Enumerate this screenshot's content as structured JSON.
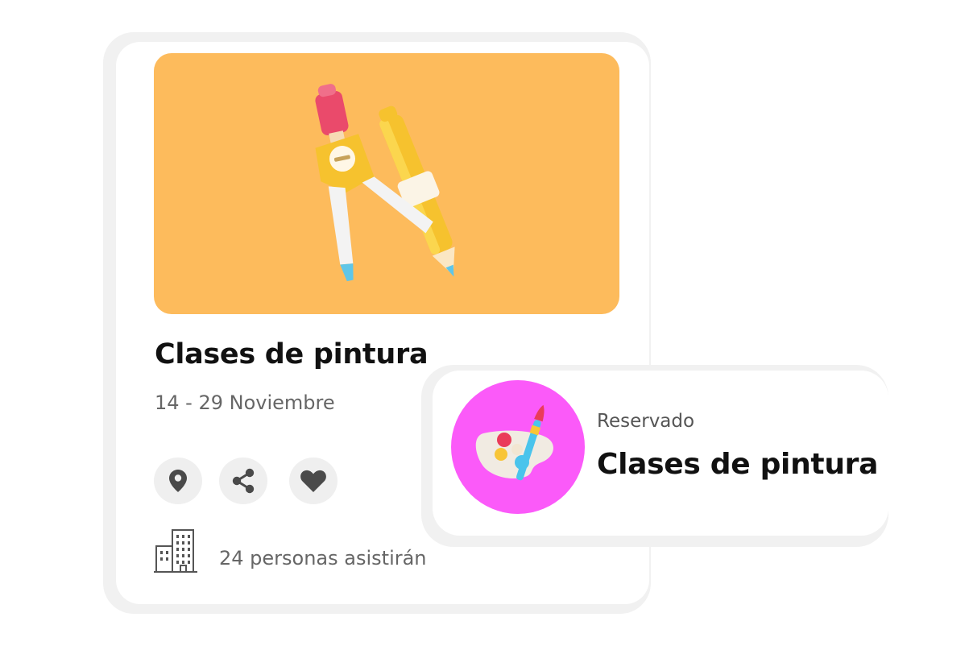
{
  "event": {
    "title": "Clases de pintura",
    "dates": "14 - 29 Noviembre",
    "attendees": "24 personas asistirán",
    "hero_color": "#fdbb5c",
    "hero_image": "drawing-compass-and-pencil",
    "actions": {
      "location_icon": "location-pin-icon",
      "share_icon": "share-icon",
      "like_icon": "heart-icon"
    },
    "attendees_icon": "building-icon"
  },
  "booking": {
    "status": "Reservado",
    "title": "Clases de pintura",
    "thumb_color": "#fb5af9",
    "thumb_image": "paint-palette-and-brush"
  }
}
